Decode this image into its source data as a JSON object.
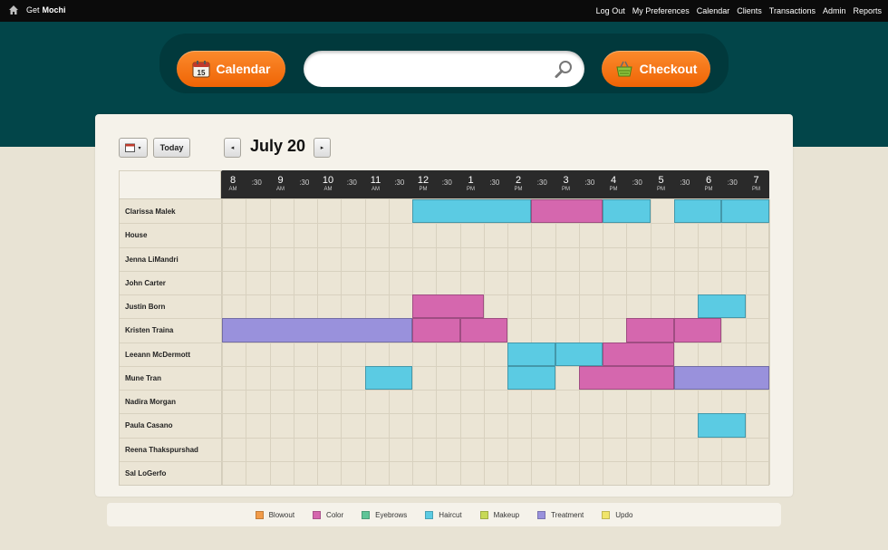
{
  "topbar": {
    "brand_get": "Get",
    "brand_name": "Mochi",
    "nav": [
      "Log Out",
      "My Preferences",
      "Calendar",
      "Clients",
      "Transactions",
      "Admin",
      "Reports"
    ]
  },
  "header": {
    "calendar_button": "Calendar",
    "checkout_button": "Checkout",
    "calendar_icon_day": "15",
    "search_value": ""
  },
  "toolbar": {
    "today_label": "Today",
    "date_title": "July 20",
    "prev_glyph": "◂",
    "next_glyph": "▸",
    "date_menu_glyph": "▾"
  },
  "timeline": {
    "ticks": [
      {
        "hour": "8",
        "ampm": "AM"
      },
      {
        "half": ":30"
      },
      {
        "hour": "9",
        "ampm": "AM"
      },
      {
        "half": ":30"
      },
      {
        "hour": "10",
        "ampm": "AM"
      },
      {
        "half": ":30"
      },
      {
        "hour": "11",
        "ampm": "AM"
      },
      {
        "half": ":30"
      },
      {
        "hour": "12",
        "ampm": "PM"
      },
      {
        "half": ":30"
      },
      {
        "hour": "1",
        "ampm": "PM"
      },
      {
        "half": ":30"
      },
      {
        "hour": "2",
        "ampm": "PM"
      },
      {
        "half": ":30"
      },
      {
        "hour": "3",
        "ampm": "PM"
      },
      {
        "half": ":30"
      },
      {
        "hour": "4",
        "ampm": "PM"
      },
      {
        "half": ":30"
      },
      {
        "hour": "5",
        "ampm": "PM"
      },
      {
        "half": ":30"
      },
      {
        "hour": "6",
        "ampm": "PM"
      },
      {
        "half": ":30"
      },
      {
        "hour": "7",
        "ampm": "PM"
      }
    ]
  },
  "staff": [
    {
      "name": "Clarissa Malek",
      "appointments": [
        {
          "service": "Haircut",
          "start": "12:00 PM",
          "end": "2:30 PM"
        },
        {
          "service": "Color",
          "start": "2:30 PM",
          "end": "4:00 PM"
        },
        {
          "service": "Haircut",
          "start": "4:00 PM",
          "end": "5:00 PM"
        },
        {
          "service": "Haircut",
          "start": "5:30 PM",
          "end": "6:30 PM"
        },
        {
          "service": "Haircut",
          "start": "6:30 PM",
          "end": "7:30 PM"
        }
      ]
    },
    {
      "name": "House",
      "appointments": []
    },
    {
      "name": "Jenna LiMandri",
      "appointments": []
    },
    {
      "name": "John Carter",
      "appointments": []
    },
    {
      "name": "Justin Born",
      "appointments": [
        {
          "service": "Color",
          "start": "12:00 PM",
          "end": "1:30 PM"
        },
        {
          "service": "Haircut",
          "start": "6:00 PM",
          "end": "7:00 PM"
        }
      ]
    },
    {
      "name": "Kristen Traina",
      "appointments": [
        {
          "service": "Treatment",
          "start": "8:00 AM",
          "end": "12:00 PM"
        },
        {
          "service": "Color",
          "start": "12:00 PM",
          "end": "1:00 PM"
        },
        {
          "service": "Color",
          "start": "1:00 PM",
          "end": "2:00 PM"
        },
        {
          "service": "Color",
          "start": "4:30 PM",
          "end": "5:30 PM"
        },
        {
          "service": "Color",
          "start": "5:30 PM",
          "end": "6:30 PM"
        }
      ]
    },
    {
      "name": "Leeann McDermott",
      "appointments": [
        {
          "service": "Haircut",
          "start": "2:00 PM",
          "end": "3:00 PM"
        },
        {
          "service": "Haircut",
          "start": "3:00 PM",
          "end": "4:00 PM"
        },
        {
          "service": "Color",
          "start": "4:00 PM",
          "end": "5:30 PM"
        }
      ]
    },
    {
      "name": "Mune Tran",
      "appointments": [
        {
          "service": "Haircut",
          "start": "11:00 AM",
          "end": "12:00 PM"
        },
        {
          "service": "Haircut",
          "start": "2:00 PM",
          "end": "3:00 PM"
        },
        {
          "service": "Color",
          "start": "3:30 PM",
          "end": "5:30 PM"
        },
        {
          "service": "Treatment",
          "start": "5:30 PM",
          "end": "7:30 PM"
        }
      ]
    },
    {
      "name": "Nadira Morgan",
      "appointments": []
    },
    {
      "name": "Paula Casano",
      "appointments": [
        {
          "service": "Haircut",
          "start": "6:00 PM",
          "end": "7:00 PM"
        }
      ]
    },
    {
      "name": "Reena Thakspurshad",
      "appointments": []
    },
    {
      "name": "Sal LoGerfo",
      "appointments": []
    }
  ],
  "legend": [
    {
      "label": "Blowout",
      "color": "#f29b48"
    },
    {
      "label": "Color",
      "color": "#d567ae"
    },
    {
      "label": "Eyebrows",
      "color": "#5fc597"
    },
    {
      "label": "Haircut",
      "color": "#5bcbe3"
    },
    {
      "label": "Makeup",
      "color": "#c7d957"
    },
    {
      "label": "Treatment",
      "color": "#9991dc"
    },
    {
      "label": "Updo",
      "color": "#f1e56a"
    }
  ],
  "colors": {
    "topbar": "#0b0b0b",
    "header_bg": "#024549",
    "accent_orange": "#f27515",
    "grid_bg": "#ebe5d5"
  }
}
